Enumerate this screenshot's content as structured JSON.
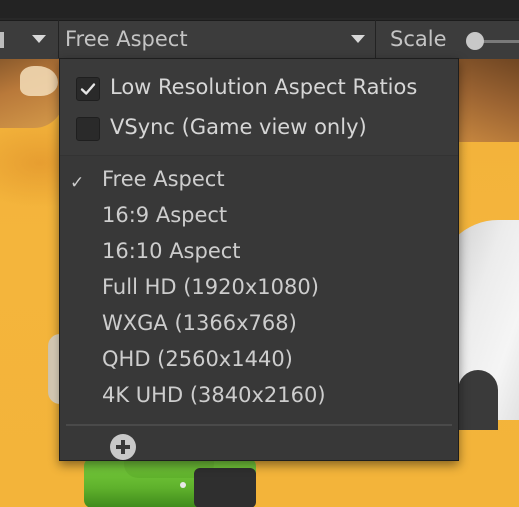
{
  "toolbar": {
    "aspect_dropdown_label": "Free Aspect",
    "scale_label": "Scale"
  },
  "popup": {
    "toggles": [
      {
        "label": "Low Resolution Aspect Ratios",
        "checked": true
      },
      {
        "label": "VSync (Game view only)",
        "checked": false
      }
    ],
    "presets": [
      {
        "label": "Free Aspect",
        "selected": true
      },
      {
        "label": "16:9 Aspect",
        "selected": false
      },
      {
        "label": "16:10 Aspect",
        "selected": false
      },
      {
        "label": "Full HD (1920x1080)",
        "selected": false
      },
      {
        "label": "WXGA (1366x768)",
        "selected": false
      },
      {
        "label": "QHD (2560x1440)",
        "selected": false
      },
      {
        "label": "4K UHD (3840x2160)",
        "selected": false
      }
    ],
    "selected_mark": "✓",
    "add_icon": "plus-circle-icon"
  },
  "colors": {
    "popup_bg": "#383838",
    "toolbar_bg": "#3c3c3c",
    "text": "#cdcdcd",
    "scene_sand": "#f3b43a"
  }
}
